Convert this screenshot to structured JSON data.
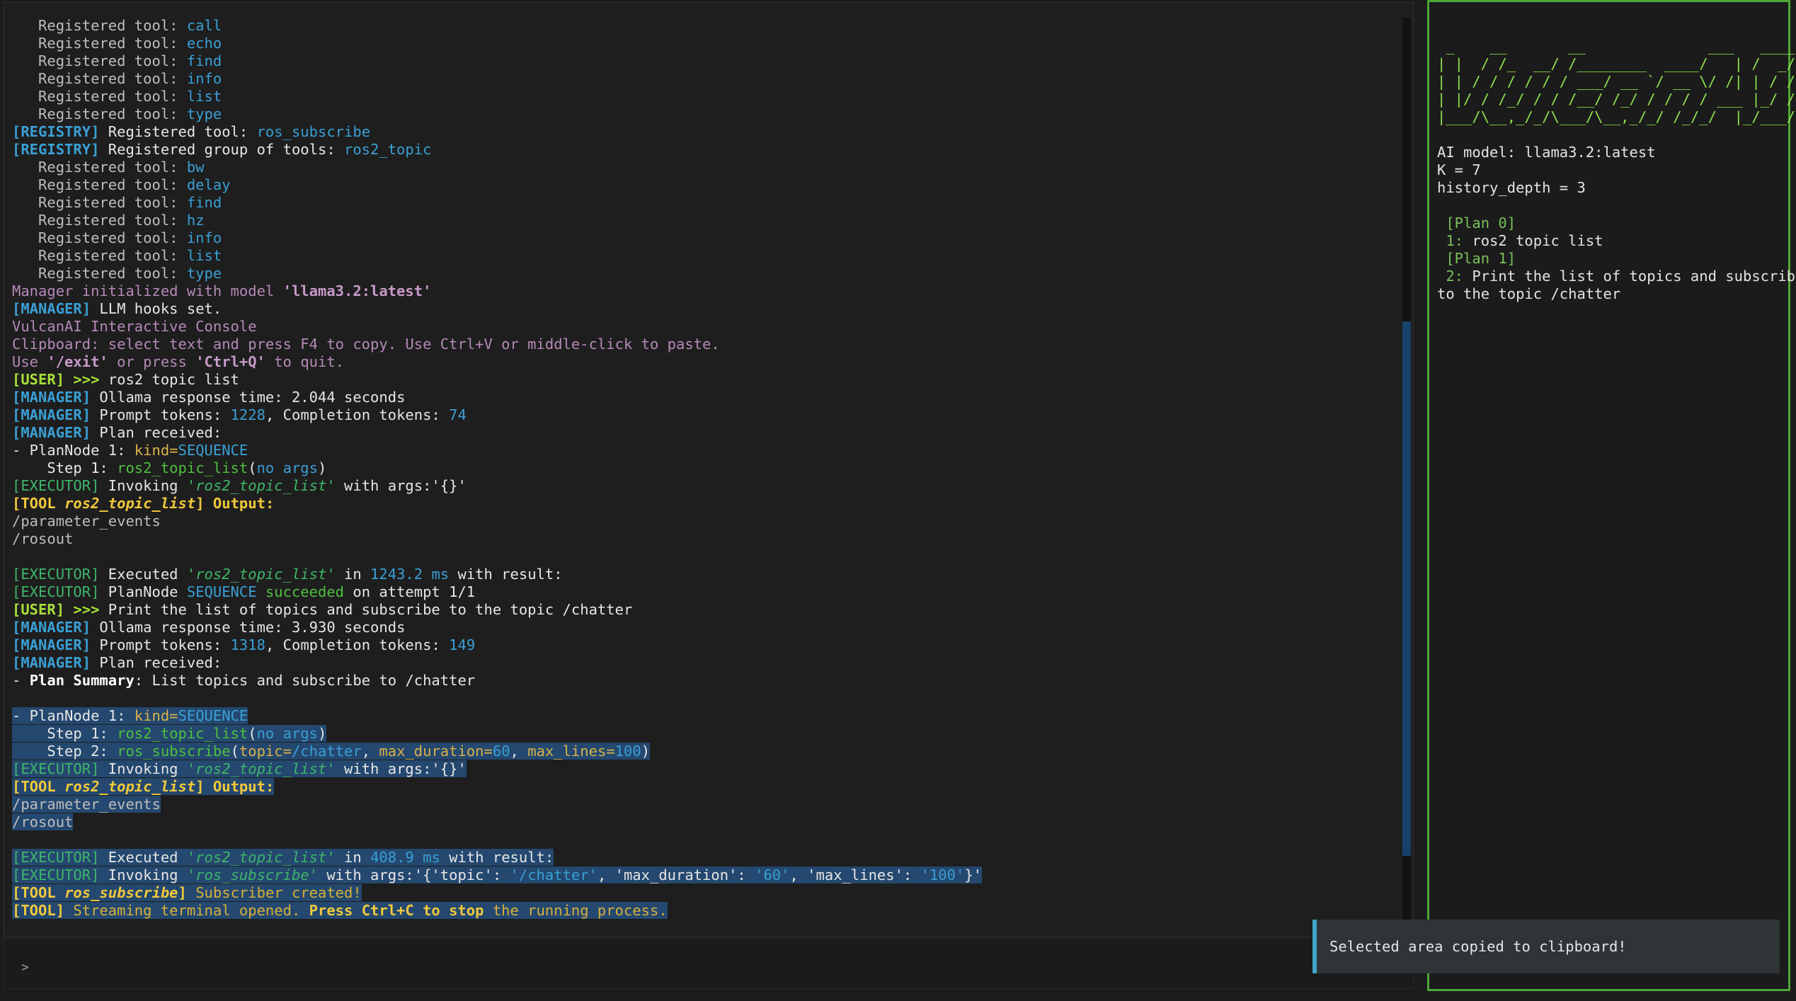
{
  "console": {
    "lines": [
      [
        [
          "dim",
          "   Registered tool: "
        ],
        [
          "cy",
          "call"
        ]
      ],
      [
        [
          "dim",
          "   Registered tool: "
        ],
        [
          "cy",
          "echo"
        ]
      ],
      [
        [
          "dim",
          "   Registered tool: "
        ],
        [
          "cy",
          "find"
        ]
      ],
      [
        [
          "dim",
          "   Registered tool: "
        ],
        [
          "cy",
          "info"
        ]
      ],
      [
        [
          "dim",
          "   Registered tool: "
        ],
        [
          "cy",
          "list"
        ]
      ],
      [
        [
          "dim",
          "   Registered tool: "
        ],
        [
          "cy",
          "type"
        ]
      ],
      [
        [
          "reg",
          "[REGISTRY]"
        ],
        [
          "wht",
          " Registered tool: "
        ],
        [
          "cy",
          "ros_subscribe"
        ]
      ],
      [
        [
          "reg",
          "[REGISTRY]"
        ],
        [
          "wht",
          " Registered group of tools: "
        ],
        [
          "cy",
          "ros2_topic"
        ]
      ],
      [
        [
          "dim",
          "   Registered tool: "
        ],
        [
          "cy",
          "bw"
        ]
      ],
      [
        [
          "dim",
          "   Registered tool: "
        ],
        [
          "cy",
          "delay"
        ]
      ],
      [
        [
          "dim",
          "   Registered tool: "
        ],
        [
          "cy",
          "find"
        ]
      ],
      [
        [
          "dim",
          "   Registered tool: "
        ],
        [
          "cy",
          "hz"
        ]
      ],
      [
        [
          "dim",
          "   Registered tool: "
        ],
        [
          "cy",
          "info"
        ]
      ],
      [
        [
          "dim",
          "   Registered tool: "
        ],
        [
          "cy",
          "list"
        ]
      ],
      [
        [
          "dim",
          "   Registered tool: "
        ],
        [
          "cy",
          "type"
        ]
      ],
      [
        [
          "pur",
          "Manager initialized with model "
        ],
        [
          "purb",
          "'llama3.2:latest'"
        ]
      ],
      [
        [
          "mgr",
          "[MANAGER]"
        ],
        [
          "wht",
          " LLM hooks set."
        ]
      ],
      [
        [
          "pur",
          "VulcanAI Interactive Console"
        ]
      ],
      [
        [
          "pur",
          "Clipboard: select text and press F4 to copy. Use Ctrl+V or middle-click to paste."
        ]
      ],
      [
        [
          "pur",
          "Use "
        ],
        [
          "purb",
          "'/exit'"
        ],
        [
          "pur",
          " or press "
        ],
        [
          "purb",
          "'Ctrl+Q'"
        ],
        [
          "pur",
          " to quit."
        ]
      ],
      [
        [
          "usr",
          "[USER] >>>"
        ],
        [
          "wht",
          " ros2 topic list"
        ]
      ],
      [
        [
          "mgr",
          "[MANAGER]"
        ],
        [
          "wht",
          " Ollama response time: 2.044 seconds"
        ]
      ],
      [
        [
          "mgr",
          "[MANAGER]"
        ],
        [
          "wht",
          " Prompt tokens: "
        ],
        [
          "blu",
          "1228"
        ],
        [
          "wht",
          ", Completion tokens: "
        ],
        [
          "blu",
          "74"
        ]
      ],
      [
        [
          "mgr",
          "[MANAGER]"
        ],
        [
          "wht",
          " Plan received:"
        ]
      ],
      [
        [
          "wht",
          "- PlanNode 1: "
        ],
        [
          "ylw",
          "kind="
        ],
        [
          "blu",
          "SEQUENCE"
        ]
      ],
      [
        [
          "wht",
          "    Step 1: "
        ],
        [
          "grn",
          "ros2_topic_list"
        ],
        [
          "wht",
          "("
        ],
        [
          "blu",
          "no args"
        ],
        [
          "wht",
          ")"
        ]
      ],
      [
        [
          "exe",
          "[EXECUTOR]"
        ],
        [
          "wht",
          " Invoking "
        ],
        [
          "exe it",
          "'ros2_topic_list'"
        ],
        [
          "wht",
          " with args:'{}'"
        ]
      ],
      [
        [
          "tl",
          "[TOOL "
        ],
        [
          "tl it",
          "ros2_topic_list"
        ],
        [
          "tl",
          "] Output:"
        ]
      ],
      [
        [
          "dim",
          "/parameter_events"
        ]
      ],
      [
        [
          "dim",
          "/rosout"
        ]
      ],
      [],
      [
        [
          "exe",
          "[EXECUTOR]"
        ],
        [
          "wht",
          " Executed "
        ],
        [
          "exe it",
          "'ros2_topic_list'"
        ],
        [
          "wht",
          " in "
        ],
        [
          "blu",
          "1243.2 ms"
        ],
        [
          "wht",
          " with result:"
        ]
      ],
      [
        [
          "exe",
          "[EXECUTOR]"
        ],
        [
          "wht",
          " PlanNode "
        ],
        [
          "blu",
          "SEQUENCE"
        ],
        [
          "grn",
          " succeeded"
        ],
        [
          "wht",
          " on attempt 1/1"
        ]
      ],
      [
        [
          "usr",
          "[USER] >>>"
        ],
        [
          "wht",
          " Print the list of topics and subscribe to the topic /chatter"
        ]
      ],
      [
        [
          "mgr",
          "[MANAGER]"
        ],
        [
          "wht",
          " Ollama response time: 3.930 seconds"
        ]
      ],
      [
        [
          "mgr",
          "[MANAGER]"
        ],
        [
          "wht",
          " Prompt tokens: "
        ],
        [
          "blu",
          "1318"
        ],
        [
          "wht",
          ", Completion tokens: "
        ],
        [
          "blu",
          "149"
        ]
      ],
      [
        [
          "mgr",
          "[MANAGER]"
        ],
        [
          "wht",
          " Plan received:"
        ]
      ],
      [
        [
          "wht",
          "- "
        ],
        [
          "bld",
          "Plan Summary"
        ],
        [
          "wht",
          ": List topics and subscribe to /chatter"
        ]
      ],
      [],
      [
        [
          "wht",
          "- PlanNode 1: "
        ],
        [
          "ylw",
          "kind="
        ],
        [
          "blu",
          "SEQUENCE"
        ]
      ],
      [
        [
          "wht",
          "    Step 1: "
        ],
        [
          "grn",
          "ros2_topic_list"
        ],
        [
          "wht",
          "("
        ],
        [
          "blu",
          "no args"
        ],
        [
          "wht",
          ")"
        ]
      ],
      [
        [
          "wht",
          "    Step 2: "
        ],
        [
          "grn",
          "ros_subscribe"
        ],
        [
          "wht",
          "("
        ],
        [
          "ylw",
          "topic="
        ],
        [
          "blu",
          "/chatter"
        ],
        [
          "wht",
          ", "
        ],
        [
          "ylw",
          "max_duration="
        ],
        [
          "blu",
          "60"
        ],
        [
          "wht",
          ", "
        ],
        [
          "ylw",
          "max_lines="
        ],
        [
          "blu",
          "100"
        ],
        [
          "wht",
          ")"
        ]
      ],
      [
        [
          "exe",
          "[EXECUTOR]"
        ],
        [
          "wht",
          " Invoking "
        ],
        [
          "exe it",
          "'ros2_topic_list'"
        ],
        [
          "wht",
          " with args:'{}'"
        ]
      ],
      [
        [
          "tl",
          "[TOOL "
        ],
        [
          "tl it",
          "ros2_topic_list"
        ],
        [
          "tl",
          "] Output:"
        ]
      ],
      [
        [
          "dim",
          "/parameter_events"
        ]
      ],
      [
        [
          "dim",
          "/rosout"
        ]
      ],
      [],
      [
        [
          "exe",
          "[EXECUTOR]"
        ],
        [
          "wht",
          " Executed "
        ],
        [
          "exe it",
          "'ros2_topic_list'"
        ],
        [
          "wht",
          " in "
        ],
        [
          "blu",
          "408.9 ms"
        ],
        [
          "wht",
          " with result:"
        ]
      ],
      [
        [
          "exe",
          "[EXECUTOR]"
        ],
        [
          "wht",
          " Invoking "
        ],
        [
          "exe it",
          "'ros_subscribe'"
        ],
        [
          "wht",
          " with args:'{'topic': "
        ],
        [
          "blu",
          "'/chatter'"
        ],
        [
          "wht",
          ", 'max_duration': "
        ],
        [
          "blu",
          "'60'"
        ],
        [
          "wht",
          ", 'max_lines': "
        ],
        [
          "blu",
          "'100'"
        ],
        [
          "wht",
          "}'"
        ]
      ],
      [
        [
          "tl",
          "[TOOL "
        ],
        [
          "tl it",
          "ros_subscribe"
        ],
        [
          "tl",
          "]"
        ],
        [
          "tlt",
          " Subscriber created!"
        ]
      ],
      [
        [
          "tl",
          "[TOOL]"
        ],
        [
          "tlt",
          " Streaming terminal opened. "
        ],
        [
          "tl",
          "Press Ctrl+C to stop"
        ],
        [
          "tlt",
          " the running process."
        ]
      ]
    ],
    "selection_start": 39
  },
  "prompt": {
    "symbol": ">"
  },
  "sidebar": {
    "banner": [
      " _    __       __              ___   ____",
      "| |  / /_  __/ /________  ____/   | /  _/",
      "| | / / / / / / ___/ __ `/ __ \\/ /| | / /  ",
      "| |/ / /_/ / / /__/ /_/ / / / / ___ |_/ /   ",
      "|___/\\__,_/_/\\___/\\__,_/_/ /_/_/  |_/___/   "
    ],
    "ai_model": "AI model: llama3.2:latest",
    "k": "K = 7",
    "history_depth": "history_depth = 3",
    "plans": [
      {
        "header": " [Plan 0]",
        "num": " 1:",
        "text": " ros2 topic list"
      },
      {
        "header": " [Plan 1]",
        "num": " 2:",
        "text": " Print the list of topics and subscribe"
      }
    ],
    "plan_wrap": "to the topic /chatter"
  },
  "toast": {
    "message": "Selected area copied to clipboard!"
  }
}
